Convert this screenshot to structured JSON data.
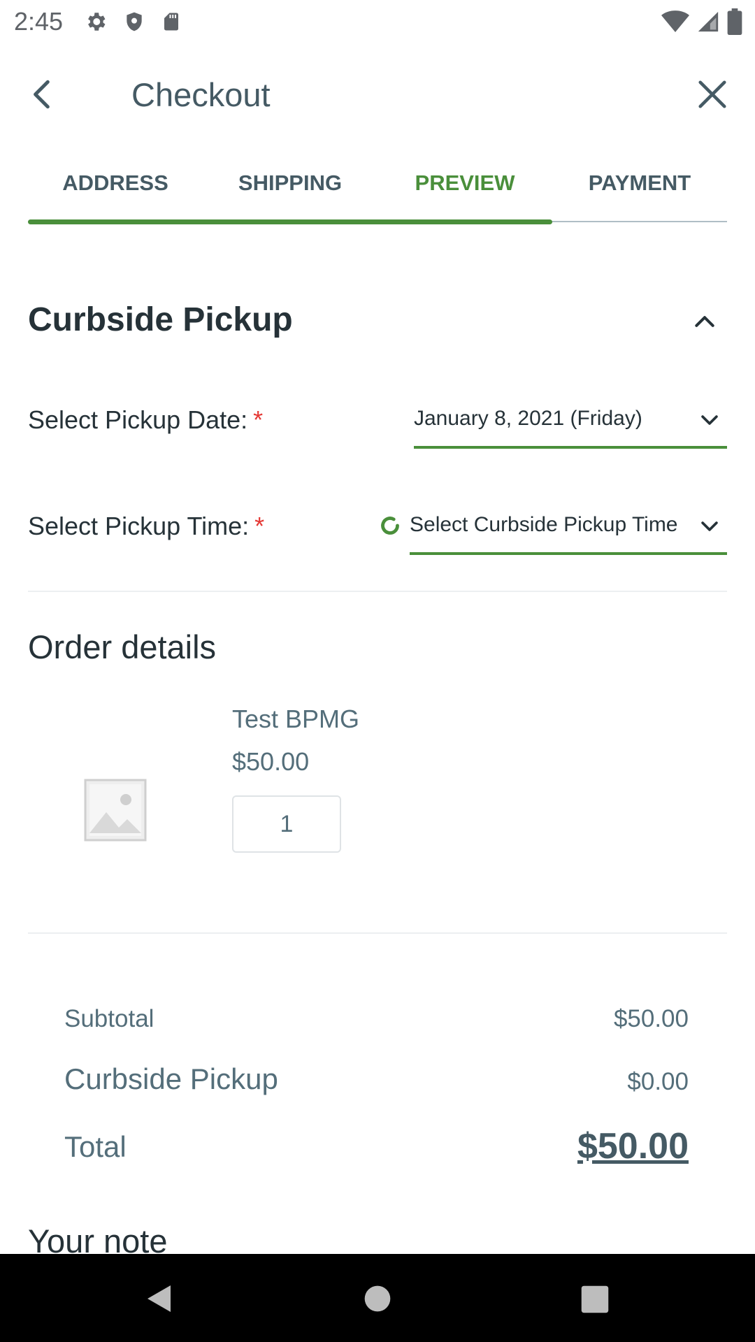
{
  "status_bar": {
    "time": "2:45",
    "left_icons": [
      "gear-icon",
      "shield-icon",
      "sd-card-icon"
    ],
    "right_icons": [
      "wifi-icon",
      "signal-icon",
      "battery-icon"
    ]
  },
  "app_bar": {
    "title": "Checkout",
    "back_icon": "chevron-left-icon",
    "close_icon": "close-icon"
  },
  "tabs": {
    "items": [
      {
        "label": "ADDRESS",
        "state": "completed"
      },
      {
        "label": "SHIPPING",
        "state": "completed"
      },
      {
        "label": "PREVIEW",
        "state": "active"
      },
      {
        "label": "PAYMENT",
        "state": "pending"
      }
    ],
    "progress_fraction": 0.75
  },
  "colors": {
    "accent": "#4a8f3b",
    "required": "#e53935",
    "text_primary": "#263238",
    "text_secondary": "#546e7a"
  },
  "curbside": {
    "title": "Curbside Pickup",
    "date_label": "Select Pickup Date:",
    "date_value": "January 8, 2021 (Friday)",
    "time_label": "Select Pickup Time:",
    "time_placeholder": "Select Curbside Pickup Time",
    "required_mark": "*"
  },
  "order": {
    "heading": "Order details",
    "items": [
      {
        "name": "Test BPMG",
        "price": "$50.00",
        "quantity": "1"
      }
    ]
  },
  "totals": {
    "subtotal_label": "Subtotal",
    "subtotal_value": "$50.00",
    "pickup_label": "Curbside Pickup",
    "pickup_value": "$0.00",
    "total_label": "Total",
    "total_value": "$50.00"
  },
  "note": {
    "heading": "Your note"
  },
  "nav_bar": {
    "icons": [
      "nav-back-icon",
      "nav-home-icon",
      "nav-recents-icon"
    ]
  }
}
